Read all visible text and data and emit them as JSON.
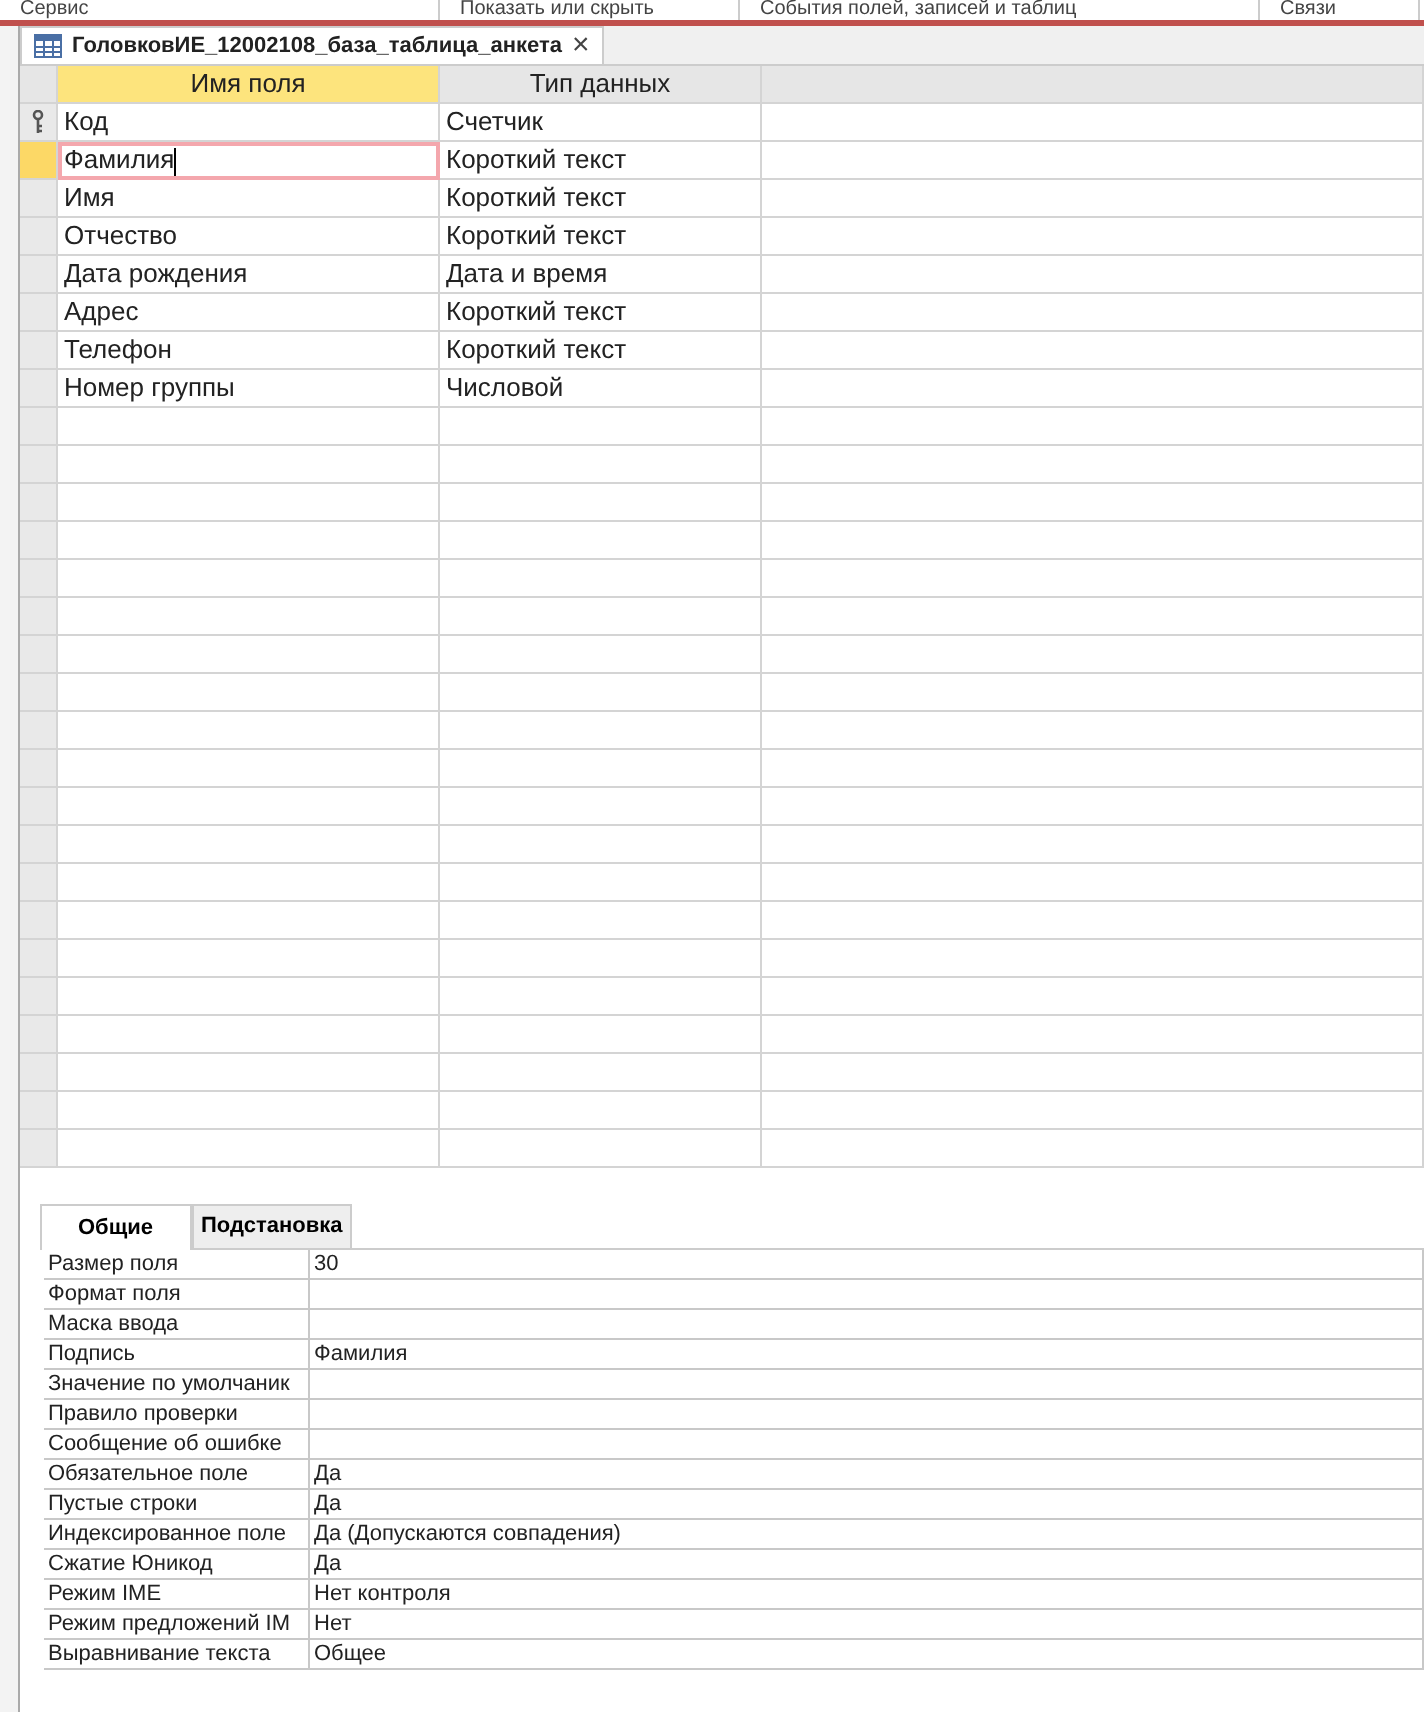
{
  "ribbon_groups": [
    "Сервис",
    "Показать или скрыть",
    "События полей, записей и таблиц",
    "Связи"
  ],
  "document_tab": {
    "title": "ГоловковИЕ_12002108_база_таблица_анкета",
    "close": "×"
  },
  "table": {
    "columns": [
      "Имя поля",
      "Тип данных"
    ],
    "rows": [
      {
        "field": "Код",
        "type": "Счетчик",
        "primary_key": true,
        "selected": false
      },
      {
        "field": "Фамилия",
        "type": "Короткий текст",
        "primary_key": false,
        "selected": true
      },
      {
        "field": "Имя",
        "type": "Короткий текст",
        "primary_key": false,
        "selected": false
      },
      {
        "field": "Отчество",
        "type": "Короткий текст",
        "primary_key": false,
        "selected": false
      },
      {
        "field": "Дата рождения",
        "type": "Дата и время",
        "primary_key": false,
        "selected": false
      },
      {
        "field": "Адрес",
        "type": "Короткий текст",
        "primary_key": false,
        "selected": false
      },
      {
        "field": "Телефон",
        "type": "Короткий текст",
        "primary_key": false,
        "selected": false
      },
      {
        "field": "Номер группы",
        "type": "Числовой",
        "primary_key": false,
        "selected": false
      }
    ]
  },
  "properties": {
    "tabs": [
      {
        "label": "Общие",
        "selected": true
      },
      {
        "label": "Подстановка",
        "selected": false
      }
    ],
    "rows": [
      {
        "label": "Размер поля",
        "value": "30"
      },
      {
        "label": "Формат поля",
        "value": ""
      },
      {
        "label": "Маска ввода",
        "value": ""
      },
      {
        "label": "Подпись",
        "value": "Фамилия"
      },
      {
        "label": "Значение по умолчаник",
        "value": ""
      },
      {
        "label": "Правило проверки",
        "value": ""
      },
      {
        "label": "Сообщение об ошибке",
        "value": ""
      },
      {
        "label": "Обязательное поле",
        "value": "Да"
      },
      {
        "label": "Пустые строки",
        "value": "Да"
      },
      {
        "label": "Индексированное поле",
        "value": "Да (Допускаются совпадения)"
      },
      {
        "label": "Сжатие Юникод",
        "value": "Да"
      },
      {
        "label": "Режим IME",
        "value": "Нет контроля"
      },
      {
        "label": "Режим предложений IM",
        "value": "Нет"
      },
      {
        "label": "Выравнивание текста",
        "value": "Общее"
      }
    ]
  }
}
